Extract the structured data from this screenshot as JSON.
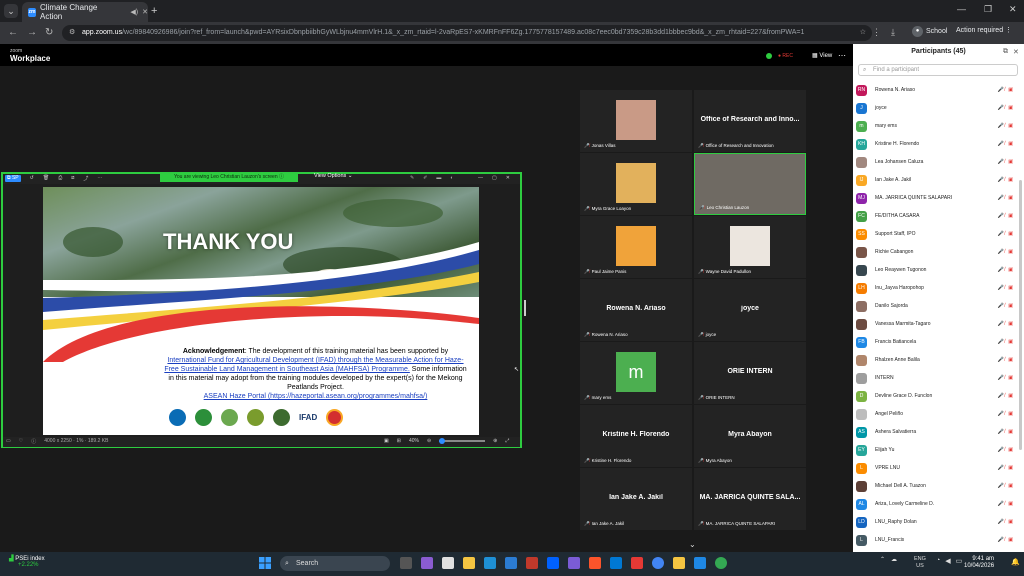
{
  "browser": {
    "tab_title": "Climate Change Action",
    "url_host": "app.zoom.us",
    "url_rest": "/wc/89840926986/join?ref_from=launch&pwd=AYRsixDbnpbiibhGyWLbjnu4mmVlrH.1&_x_zm_rtaid=l-2vaRpES7-xKMRFnFF6Zg.1775778157489.ac08c7eec0bd7359c28b3dd1bbbec9bd&_x_zm_rhtaid=227&fromPWA=1",
    "profile": "School",
    "action_required": "Action required"
  },
  "zoom": {
    "logo_small": "zoom",
    "logo_big": "Workplace",
    "rec_label": "REC",
    "view_label": "View"
  },
  "share": {
    "viewing": "You are viewing  Leo Christian Lauzon's screen",
    "view_options": "View Options",
    "zoom_pct": "40%",
    "file_info": "4000 x 2250 · 1% · 189.2 KB",
    "slide": {
      "title": "THANK YOU",
      "ack_label": "Acknowledgement",
      "ack_text1": ": The development of this training material has been supported by",
      "ack_link": "International Fund for Agricultural Development (IFAD) through the Measurable Action for Haze-Free Sustainable Land Management in Southeast Asia (MAHFSA) Programme.",
      "ack_text2": "Some information in this material may adopt from the training modules developed by the expert(s) for the Mekong Peatlands Project.",
      "portal": "ASEAN Haze Portal (https://hazeportal.asean.org/programmes/mahfsa/)",
      "ifad": "IFAD"
    }
  },
  "gallery": [
    {
      "name": "Jonas Villas",
      "big": "",
      "photo": "#c99a86"
    },
    {
      "name": "Office of Research and Innovation",
      "big": "Office of Research and Inno...",
      "photo": ""
    },
    {
      "name": "Myra Grace Loayon",
      "big": "",
      "photo": "#e2b15c"
    },
    {
      "name": "Leo Christian Lauzon",
      "big": "",
      "photo": "#6f6a63"
    },
    {
      "name": "Paul Jaime Panis",
      "big": "",
      "photo": "#f0a33a"
    },
    {
      "name": "Wayne David Padullon",
      "big": "",
      "photo": "#ece6df"
    },
    {
      "name": "Rowena N. Ariaso",
      "big": "Rowena N. Ariaso",
      "photo": ""
    },
    {
      "name": "joyce",
      "big": "joyce",
      "photo": ""
    },
    {
      "name": "mary ems",
      "big": "m",
      "photo": "#4caf50"
    },
    {
      "name": "ORIE INTERN",
      "big": "ORIE INTERN",
      "photo": ""
    },
    {
      "name": "Kristine H. Florendo",
      "big": "Kristine H. Florendo",
      "photo": ""
    },
    {
      "name": "Myra Abayon",
      "big": "Myra Abayon",
      "photo": ""
    },
    {
      "name": "Ian Jake A. Jakil",
      "big": "Ian Jake A. Jakil",
      "photo": ""
    },
    {
      "name": "MA. JARRICA QUINTE SALAPARI",
      "big": "MA. JARRICA QUINTE SALA...",
      "photo": ""
    }
  ],
  "participants": {
    "title": "Participants (45)",
    "search_placeholder": "Find a participant",
    "list": [
      {
        "initials": "RN",
        "name": "Rowena N. Ariaso",
        "color": "#c2185b"
      },
      {
        "initials": "J",
        "name": "joyce",
        "color": "#1976d2"
      },
      {
        "initials": "m",
        "name": "mary ems",
        "color": "#4caf50"
      },
      {
        "initials": "KH",
        "name": "Kristine H. Florendo",
        "color": "#26a69a"
      },
      {
        "initials": "",
        "name": "Lea Johansen Caluza",
        "color": "#a1887f"
      },
      {
        "initials": "IJ",
        "name": "Ian Jake A. Jakil",
        "color": "#f9a825"
      },
      {
        "initials": "MJ",
        "name": "MA. JARRICA QUINTE SALAPARI",
        "color": "#8e24aa"
      },
      {
        "initials": "FC",
        "name": "FE/DITHA CASARA",
        "color": "#43a047"
      },
      {
        "initials": "SS",
        "name": "Support Staff, IPO",
        "color": "#fb8c00"
      },
      {
        "initials": "",
        "name": "Richie Cabangon",
        "color": "#795548"
      },
      {
        "initials": "",
        "name": "Leo Reaywen Tugonon",
        "color": "#37474f"
      },
      {
        "initials": "LH",
        "name": "Inu_Jayva Haropohop",
        "color": "#f57c00"
      },
      {
        "initials": "",
        "name": "Danilo Sajorda",
        "color": "#8d6e63"
      },
      {
        "initials": "",
        "name": "Vanessa Marmita-Tagaro",
        "color": "#6d4c41"
      },
      {
        "initials": "FB",
        "name": "Francis Batiancela",
        "color": "#1e88e5"
      },
      {
        "initials": "",
        "name": "Rhalzen Anne Balila",
        "color": "#b0866b"
      },
      {
        "initials": "",
        "name": "INTERN",
        "color": "#9e9e9e"
      },
      {
        "initials": "D",
        "name": "Devline Grace D. Funclon",
        "color": "#7cb342"
      },
      {
        "initials": "",
        "name": "Angel Peliño",
        "color": "#bdbdbd"
      },
      {
        "initials": "AS",
        "name": "Ashera Salvatierra",
        "color": "#0097a7"
      },
      {
        "initials": "EY",
        "name": "Elijah Yu",
        "color": "#26a69a"
      },
      {
        "initials": "L",
        "name": "VPRE LNU",
        "color": "#fb8c00"
      },
      {
        "initials": "",
        "name": "Michael Dell A. Tuazon",
        "color": "#5d4037"
      },
      {
        "initials": "AL",
        "name": "Ariza, Lovely Carmeline D.",
        "color": "#1e88e5"
      },
      {
        "initials": "LD",
        "name": "LNU_Raphy Dolan",
        "color": "#1565c0"
      },
      {
        "initials": "L",
        "name": "LNU_Francis",
        "color": "#455a64"
      }
    ]
  },
  "taskbar": {
    "stock_name": "PSEi index",
    "stock_change": "+2.22%",
    "search": "Search",
    "lang1": "ENG",
    "lang2": "US",
    "time": "9:41 am",
    "date": "10/04/2026"
  }
}
